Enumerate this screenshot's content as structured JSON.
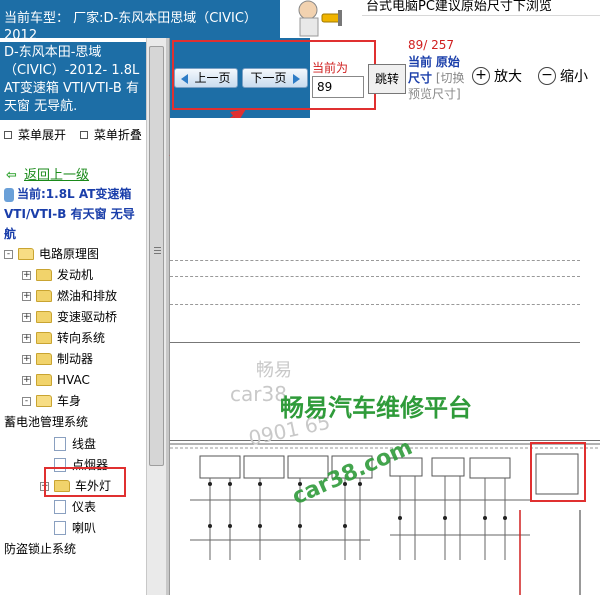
{
  "header": {
    "current_vehicle": "当前车型： 厂家:D-东风本田思域（CIVIC）2012",
    "hint": "台式电脑PC建议原始尺寸下浏览"
  },
  "sidebar": {
    "model": "D-东风本田-思域（CIVIC）-2012- 1.8L AT变速箱 VTI/VTI-B 有天窗 无导航.",
    "expand_label": "菜单展开",
    "collapse_label": "菜单折叠",
    "back_label": "返回上一级",
    "current_label": "当前:1.8L AT变速箱 VTI/VTI-B 有天窗 无导航",
    "tree": [
      {
        "label": "电路原理图",
        "level": 1,
        "type": "folder-open",
        "toggle": "-"
      },
      {
        "label": "发动机",
        "level": 2,
        "type": "folder",
        "toggle": "+"
      },
      {
        "label": "燃油和排放",
        "level": 2,
        "type": "folder",
        "toggle": "+"
      },
      {
        "label": "变速驱动桥",
        "level": 2,
        "type": "folder",
        "toggle": "+"
      },
      {
        "label": "转向系统",
        "level": 2,
        "type": "folder",
        "toggle": "+"
      },
      {
        "label": "制动器",
        "level": 2,
        "type": "folder",
        "toggle": "+"
      },
      {
        "label": "HVAC",
        "level": 2,
        "type": "folder",
        "toggle": "+"
      },
      {
        "label": "车身",
        "level": 2,
        "type": "folder-open",
        "toggle": "-"
      },
      {
        "label": "蓄电池管理系统",
        "level": 0,
        "type": "text",
        "toggle": ""
      },
      {
        "label": "线盘",
        "level": 3,
        "type": "page",
        "toggle": ""
      },
      {
        "label": "点烟器",
        "level": 3,
        "type": "page",
        "toggle": ""
      },
      {
        "label": "车外灯",
        "level": 3,
        "type": "folder",
        "toggle": "+"
      },
      {
        "label": "仪表",
        "level": 3,
        "type": "page",
        "toggle": ""
      },
      {
        "label": "喇叭",
        "level": 3,
        "type": "page",
        "toggle": ""
      },
      {
        "label": "防盗锁止系统",
        "level": 0,
        "type": "text",
        "toggle": ""
      }
    ]
  },
  "toolbar": {
    "prev_label": "上一页",
    "next_label": "下一页",
    "current_page_label": "当前为",
    "page_value": "89",
    "jump_label": "跳转",
    "page_count": "89/ 257",
    "size_current_label": "当前",
    "size_original_label": "原始尺寸",
    "size_switch_label": "[切换预览尺寸]",
    "zoom_in_label": "放大",
    "zoom_out_label": "缩小"
  },
  "watermark": {
    "brand": "畅易",
    "domain1": "car38",
    "domain2": "0901 65",
    "title": "畅易汽车维修平台",
    "site": "car38.com"
  },
  "colors": {
    "blue_panel": "#1d6ea6",
    "highlight_red": "#e03030",
    "watermark_green": "#2f9b3a"
  }
}
